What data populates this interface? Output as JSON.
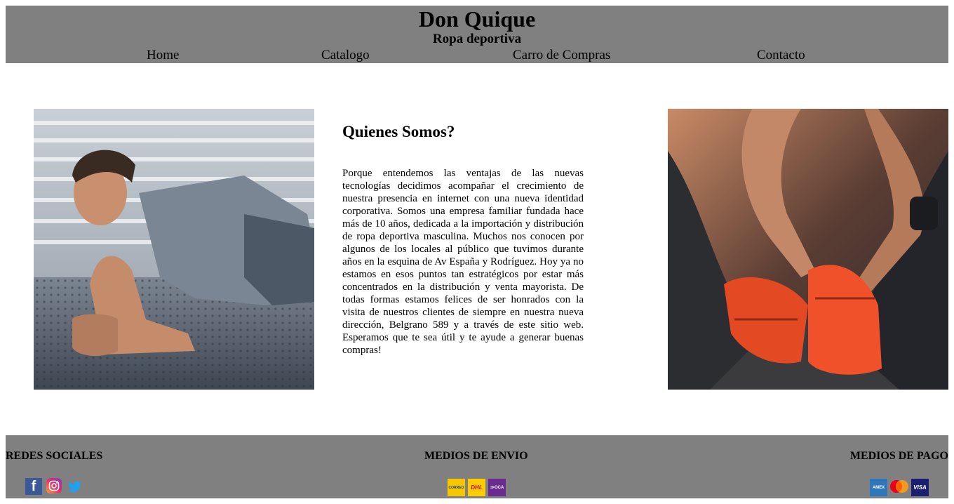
{
  "header": {
    "title": "Don Quique",
    "subtitle": "Ropa deportiva",
    "nav": [
      {
        "label": "Home"
      },
      {
        "label": "Catalogo"
      },
      {
        "label": "Carro de Compras"
      },
      {
        "label": "Contacto"
      }
    ]
  },
  "about": {
    "heading": "Quienes Somos?",
    "body": "Porque entendemos las ventajas de las nuevas tecnologías decidimos acompañar el crecimiento de nuestra presencia en internet con una nueva identidad corporativa. Somos una empresa familiar fundada hace más de 10 años, dedicada a la importación y distribución de ropa deportiva masculina. Muchos nos conocen por algunos de los locales al público que tuvimos durante años en la esquina de Av España y Rodríguez. Hoy ya no estamos en esos puntos tan estratégicos por estar más concentrados en la distribución y venta mayorista. De todas formas estamos felices de ser honrados con la visita de nuestros clientes de siempre en nuestra nueva dirección, Belgrano 589 y a través de este sitio web. Esperamos que te sea útil y te ayude a generar buenas compras!"
  },
  "footer": {
    "social": {
      "heading": "REDES SOCIALES",
      "icons": [
        "facebook-icon",
        "instagram-icon",
        "twitter-icon"
      ]
    },
    "shipping": {
      "heading": "MEDIOS DE ENVIO",
      "logos": [
        {
          "name": "correo-argentino-logo",
          "text": "CORREO",
          "bg": "#f7c600",
          "fg": "#1a3c8c"
        },
        {
          "name": "dhl-logo",
          "text": "DHL",
          "bg": "#ffcc00",
          "fg": "#d40511"
        },
        {
          "name": "oca-logo",
          "text": "≫OCA",
          "bg": "#6b2a8f",
          "fg": "#ffffff"
        }
      ]
    },
    "payment": {
      "heading": "MEDIOS DE PAGO",
      "logos": [
        {
          "name": "amex-logo",
          "text": "AMEX",
          "bg": "#2e77bc",
          "fg": "#ffffff"
        },
        {
          "name": "mastercard-logo"
        },
        {
          "name": "visa-logo",
          "text": "VISA",
          "bg": "#1a1f71",
          "fg": "#ffffff"
        }
      ]
    }
  },
  "colors": {
    "header_bg": "#808080",
    "footer_bg": "#808080",
    "facebook": "#3b5998",
    "twitter": "#1da1f2"
  }
}
